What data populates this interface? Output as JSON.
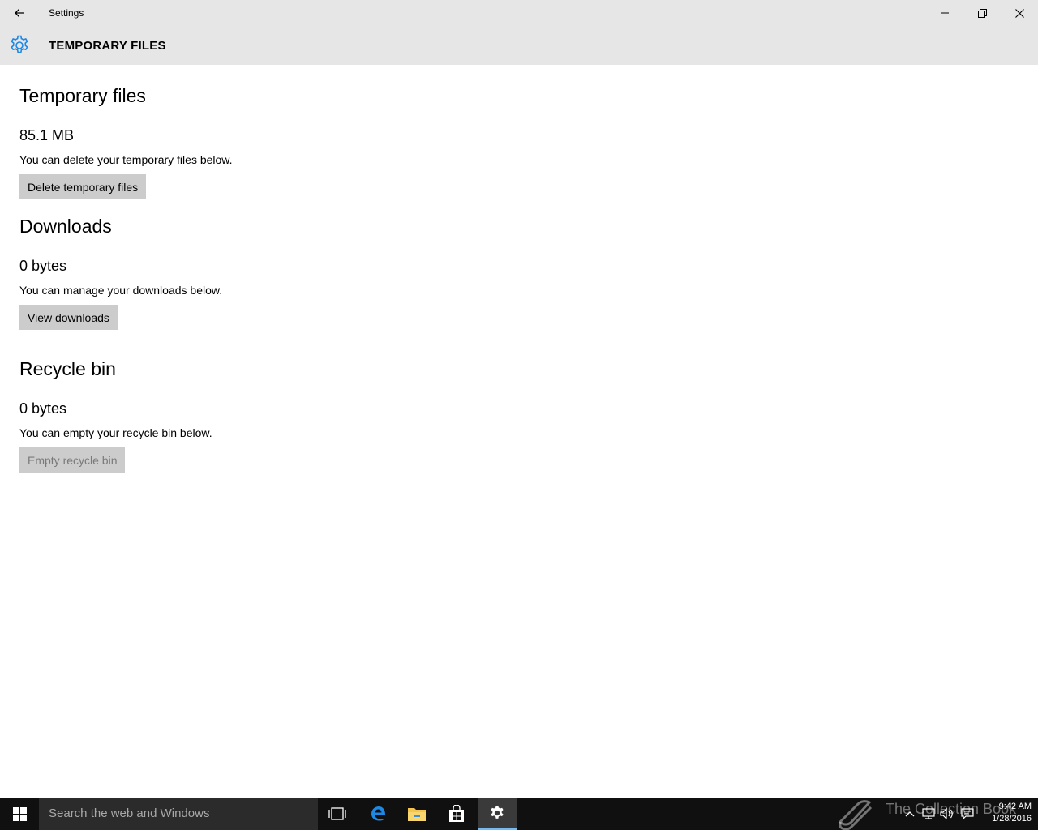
{
  "window": {
    "title": "Settings"
  },
  "header": {
    "title": "TEMPORARY FILES",
    "icon": "gear-icon"
  },
  "sections": {
    "temp": {
      "title": "Temporary files",
      "size": "85.1 MB",
      "description": "You can delete your temporary files below.",
      "button": "Delete temporary files"
    },
    "downloads": {
      "title": "Downloads",
      "size": "0 bytes",
      "description": "You can manage your downloads below.",
      "button": "View downloads"
    },
    "recycle": {
      "title": "Recycle bin",
      "size": "0 bytes",
      "description": "You can empty your recycle bin below.",
      "button": "Empty recycle bin"
    }
  },
  "taskbar": {
    "search_placeholder": "Search the web and Windows",
    "watermark": "The Collection Book",
    "time": "9:42 AM",
    "date": "1/28/2016"
  },
  "colors": {
    "accent": "#1e88e5",
    "header_bg": "#e6e6e6",
    "button_bg": "#cccccc",
    "taskbar_bg": "#101010"
  }
}
